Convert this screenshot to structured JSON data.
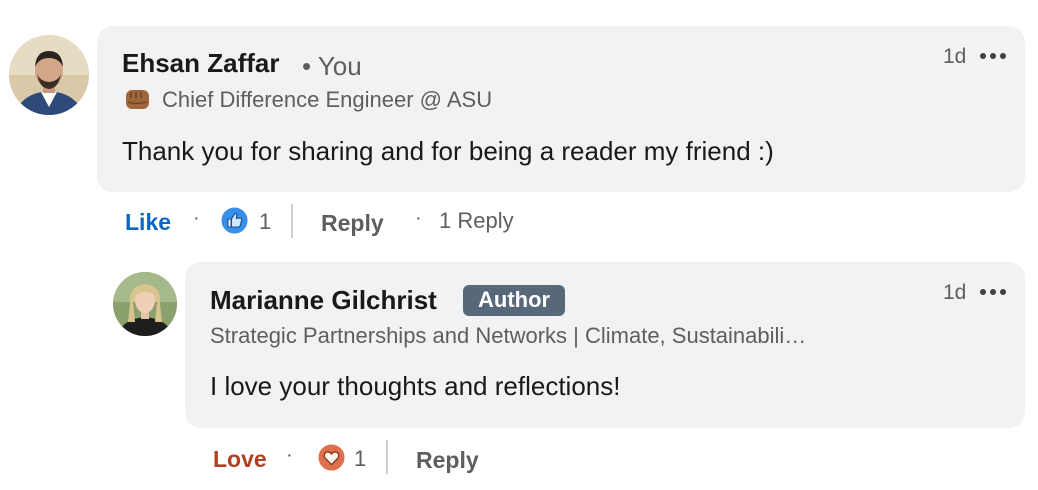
{
  "comment": {
    "author": "Ehsan Zaffar",
    "relation": "• You",
    "headline": "Chief Difference Engineer @ ASU",
    "text": "Thank you for sharing and for being a reader my friend :)",
    "time": "1d",
    "like_label": "Like",
    "like_icon": "thumbs-up-icon",
    "reaction_count": "1",
    "reply_label": "Reply",
    "replies_count": "1 Reply",
    "accent_color": "#0a66c2"
  },
  "reply": {
    "author": "Marianne Gilchrist",
    "badge": "Author",
    "headline": "Strategic Partnerships and Networks | Climate, Sustainabili…",
    "text": "I love your thoughts and reflections!",
    "time": "1d",
    "reaction_label": "Love",
    "reaction_icon": "heart-icon",
    "reaction_count": "1",
    "reply_label": "Reply",
    "accent_color": "#b24020"
  }
}
